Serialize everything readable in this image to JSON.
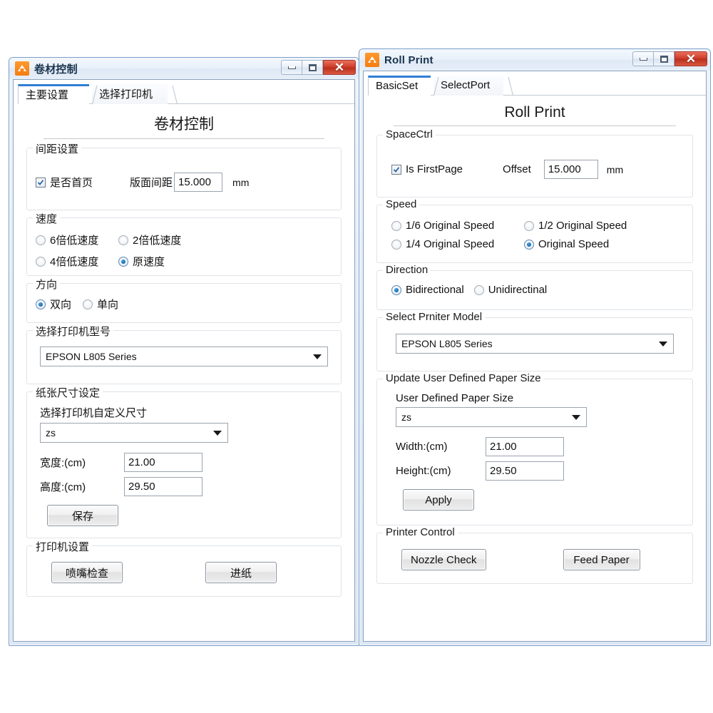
{
  "windows": {
    "left": {
      "title": "卷材控制",
      "icon": "app-home-icon",
      "controls": {
        "minimize": "minimize-icon",
        "maximize": "maximize-icon",
        "close": "✕"
      },
      "tabs": [
        {
          "label": "主要设置",
          "active": true
        },
        {
          "label": "选择打印机",
          "active": false
        }
      ],
      "page_title": "卷材控制",
      "space_group": {
        "legend": "间距设置",
        "checkbox_label": "是否首页",
        "checkbox_checked": true,
        "offset_label": "版面间距",
        "offset_value": "15.000",
        "unit": "mm"
      },
      "speed_group": {
        "legend": "速度",
        "options": [
          {
            "label": "6倍低速度",
            "selected": false
          },
          {
            "label": "2倍低速度",
            "selected": false
          },
          {
            "label": "4倍低速度",
            "selected": false
          },
          {
            "label": "原速度",
            "selected": true
          }
        ]
      },
      "direction_group": {
        "legend": "方向",
        "options": [
          {
            "label": "双向",
            "selected": true
          },
          {
            "label": "单向",
            "selected": false
          }
        ]
      },
      "printer_group": {
        "legend": "选择打印机型号",
        "selected": "EPSON L805 Series"
      },
      "paper_group": {
        "legend": "纸张尺寸设定",
        "sub_label": "选择打印机自定义尺寸",
        "size_selected": "zs",
        "width_label": "宽度:(cm)",
        "width_value": "21.00",
        "height_label": "高度:(cm)",
        "height_value": "29.50",
        "save_button": "保存"
      },
      "control_group": {
        "legend": "打印机设置",
        "nozzle_button": "喷嘴检查",
        "feed_button": "进纸"
      }
    },
    "right": {
      "title": "Roll Print",
      "icon": "app-home-icon",
      "controls": {
        "minimize": "minimize-icon",
        "maximize": "maximize-icon",
        "close": "✕"
      },
      "tabs": [
        {
          "label": "BasicSet",
          "active": true
        },
        {
          "label": "SelectPort",
          "active": false
        }
      ],
      "page_title": "Roll Print",
      "space_group": {
        "legend": "SpaceCtrl",
        "checkbox_label": "Is FirstPage",
        "checkbox_checked": true,
        "offset_label": "Offset",
        "offset_value": "15.000",
        "unit": "mm"
      },
      "speed_group": {
        "legend": "Speed",
        "options": [
          {
            "label": "1/6 Original Speed",
            "selected": false
          },
          {
            "label": "1/2 Original Speed",
            "selected": false
          },
          {
            "label": "1/4 Original Speed",
            "selected": false
          },
          {
            "label": "Original Speed",
            "selected": true
          }
        ]
      },
      "direction_group": {
        "legend": "Direction",
        "options": [
          {
            "label": "Bidirectional",
            "selected": true
          },
          {
            "label": "Unidirectinal",
            "selected": false
          }
        ]
      },
      "printer_group": {
        "legend": "Select Prniter Model",
        "selected": "EPSON L805 Series"
      },
      "paper_group": {
        "legend": "Update User Defined Paper Size",
        "sub_label": "User Defined Paper Size",
        "size_selected": "zs",
        "width_label": "Width:(cm)",
        "width_value": "21.00",
        "height_label": "Height:(cm)",
        "height_value": "29.50",
        "save_button": "Apply"
      },
      "control_group": {
        "legend": "Printer Control",
        "nozzle_button": "Nozzle Check",
        "feed_button": "Feed Paper"
      }
    }
  },
  "colors": {
    "accent_tab": "#2f7fd4",
    "close_button": "#cf3b28",
    "icon_orange": "#f47c10",
    "radio_dot": "#0e5f9e"
  }
}
